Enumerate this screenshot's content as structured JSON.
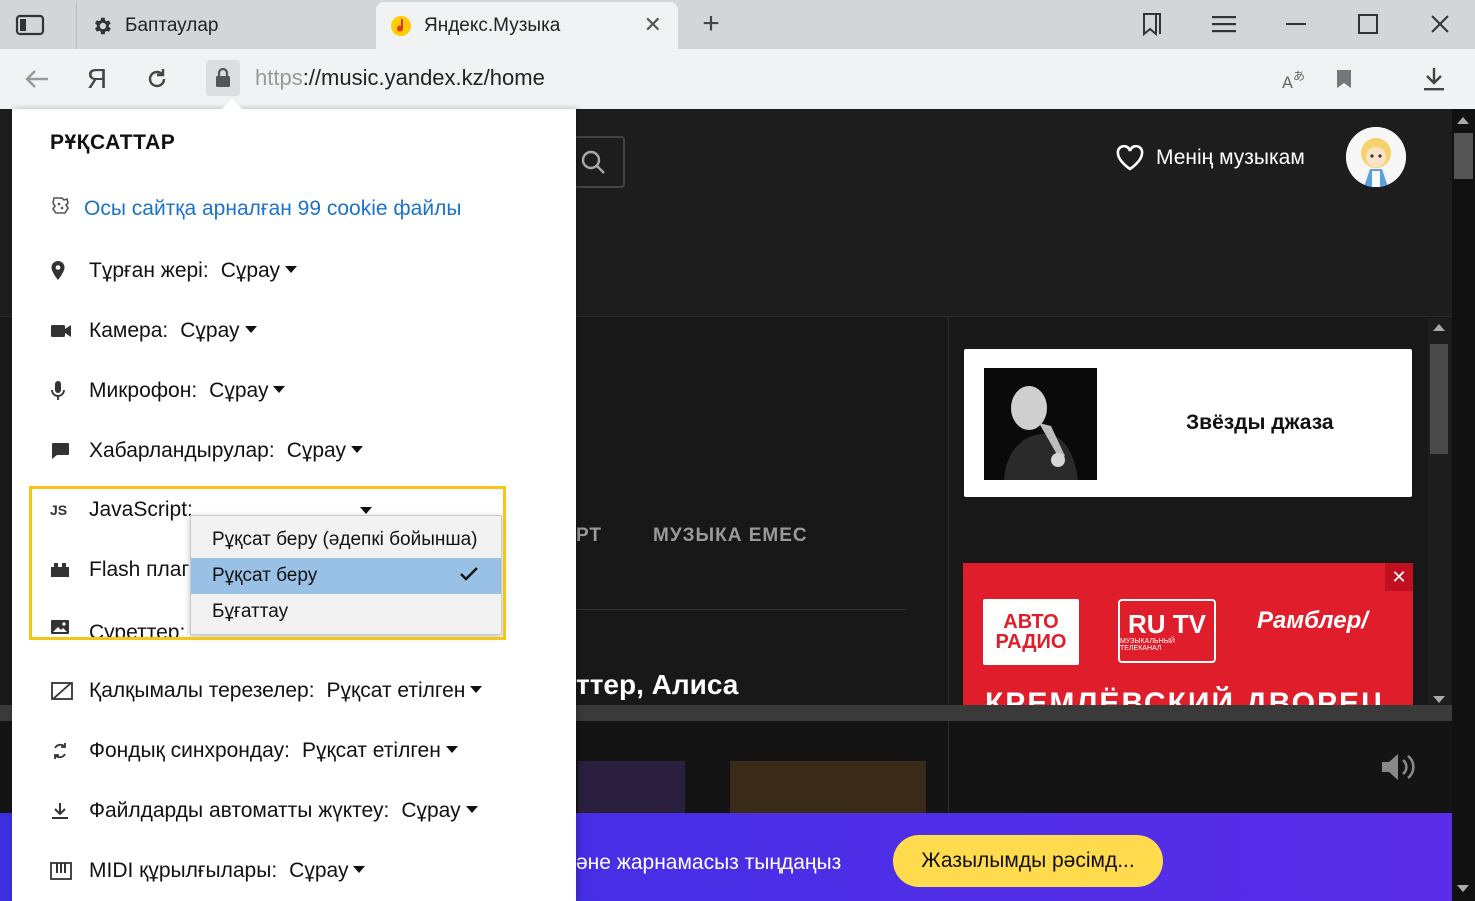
{
  "browser": {
    "tabs": [
      {
        "title": "Баптаулар",
        "icon": "gear-icon",
        "active": false
      },
      {
        "title": "Яндекс.Музыка",
        "icon": "yandex-music-icon",
        "active": true
      }
    ],
    "address": {
      "protocol": "https",
      "rest": "://music.yandex.kz/home",
      "yandex_button": "Я"
    }
  },
  "permissions": {
    "title": "РҰҚСАТТАР",
    "cookie_link": "Осы сайтқа арналған 99 cookie файлы",
    "rows": [
      {
        "icon": "location-icon",
        "label": "Тұрған жері:",
        "value": "Сұрау"
      },
      {
        "icon": "camera-icon",
        "label": "Камера:",
        "value": "Сұрау"
      },
      {
        "icon": "microphone-icon",
        "label": "Микрофон:",
        "value": "Сұрау"
      },
      {
        "icon": "notifications-icon",
        "label": "Хабарландырулар:",
        "value": "Сұрау"
      },
      {
        "icon": "javascript-icon",
        "icon_text": "JS",
        "label": "JavaScript:",
        "value": ""
      },
      {
        "icon": "plugin-icon",
        "label": "Flash плаг",
        "value": ""
      },
      {
        "icon": "image-icon",
        "label": "Суреттер:",
        "value": ""
      },
      {
        "icon": "popup-blocked-icon",
        "label": "Қалқымалы терезелер:",
        "value": "Рұқсат етілген"
      },
      {
        "icon": "sync-icon",
        "label": "Фондық синхрондау:",
        "value": "Рұқсат етілген"
      },
      {
        "icon": "download-icon",
        "label": "Файлдарды автоматты жүктеу:",
        "value": "Сұрау"
      },
      {
        "icon": "midi-icon",
        "label": "MIDI құрылғылары:",
        "value": "Сұрау"
      }
    ],
    "js_dropdown": {
      "options": [
        {
          "label": "Рұқсат беру (әдепкі бойынша)",
          "selected": false
        },
        {
          "label": "Рұқсат беру",
          "selected": true
        },
        {
          "label": "Бұғаттау",
          "selected": false
        }
      ]
    }
  },
  "site": {
    "my_music": "Менің музыкам",
    "promo_title": "Звёзды джаза",
    "nav_partial": "РТ",
    "nav_non_music": "МУЗЫКА ЕМЕС",
    "section_heading_partial": "ттер, Алиса",
    "ad": {
      "logo1": "АВТО РАДИО",
      "logo2": "RU TV",
      "logo2_sub": "МУЗЫКАЛЬНЫЙ ТЕЛЕКАНАЛ",
      "logo3": "Рамблер/",
      "bigtext": "КРЕМЛЁВСКИЙ ДВОРЕЦ",
      "close": "✕"
    },
    "subscribe_text": "әне жарнамасыз тыңдаңыз",
    "subscribe_button": "Жазылымды рәсімд..."
  },
  "colors": {
    "highlight": "#f5c518",
    "link": "#1a73c8",
    "selected_option": "#99c1e5",
    "subscribe_button": "#ffdb4d",
    "ad_background": "#e01d2a"
  }
}
